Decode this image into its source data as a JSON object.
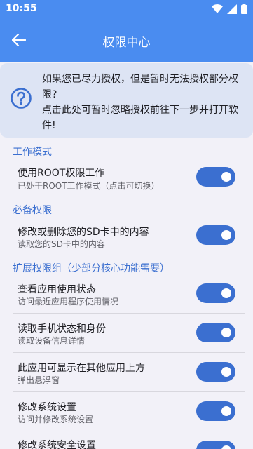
{
  "status_bar": {
    "time": "10:55"
  },
  "app_bar": {
    "title": "权限中心"
  },
  "notice": {
    "line1": "如果您已尽力授权，但是暂时无法授权部分权限?",
    "line2": "点击此处可暂时忽略授权前往下一步并打开软件!"
  },
  "sections": [
    {
      "title": "工作模式"
    },
    {
      "title": "必备权限"
    },
    {
      "title": "扩展权限组（少部分核心功能需要）"
    }
  ],
  "rows": [
    {
      "title": "使用ROOT权限工作",
      "subtitle": "已处于ROOT工作模式（点击可切换）",
      "enabled": true
    },
    {
      "title": "修改或删除您的SD卡中的内容",
      "subtitle": "读取您的SD卡中的内容",
      "enabled": true
    },
    {
      "title": "查看应用使用状态",
      "subtitle": "访问最近应用程序使用情况",
      "enabled": true
    },
    {
      "title": "读取手机状态和身份",
      "subtitle": "读取设备信息详情",
      "enabled": true
    },
    {
      "title": "此应用可显示在其他应用上方",
      "subtitle": "弹出悬浮窗",
      "enabled": true
    },
    {
      "title": "修改系统设置",
      "subtitle": "访问并修改系统设置",
      "enabled": true
    },
    {
      "title": "修改系统安全设置",
      "subtitle": "",
      "enabled": true
    }
  ],
  "colors": {
    "header": "#4a8cf0",
    "accent": "#3b6fd0",
    "notice_bg": "#dde4f4"
  }
}
